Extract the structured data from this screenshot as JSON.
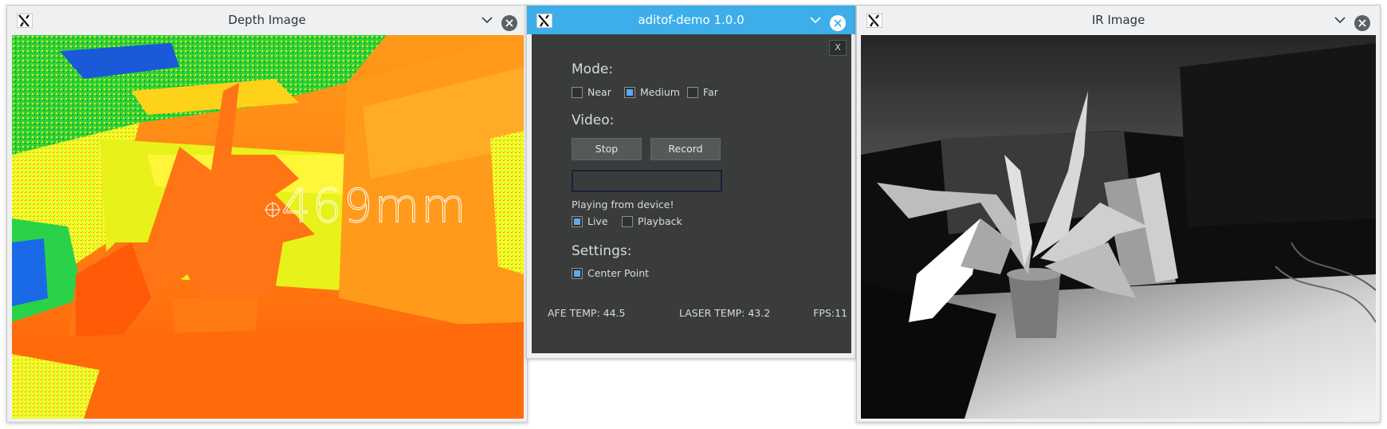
{
  "depth_window": {
    "title": "Depth Image",
    "overlay_reading": "469mm",
    "icons": {
      "app": "x11-app-icon",
      "minimize": "chevron-down-icon",
      "close": "close-icon"
    }
  },
  "demo_window": {
    "title": "aditof-demo 1.0.0",
    "close_label": "X",
    "mode": {
      "heading": "Mode:",
      "options": [
        {
          "label": "Near",
          "checked": false
        },
        {
          "label": "Medium",
          "checked": true
        },
        {
          "label": "Far",
          "checked": false
        }
      ]
    },
    "video": {
      "heading": "Video:",
      "stop_label": "Stop",
      "record_label": "Record",
      "filename_value": "",
      "status_text": "Playing from device!",
      "sources": [
        {
          "label": "Live",
          "checked": true
        },
        {
          "label": "Playback",
          "checked": false
        }
      ]
    },
    "settings": {
      "heading": "Settings:",
      "center_point_label": "Center Point",
      "center_point_checked": true
    },
    "footer": {
      "afe_temp": "AFE TEMP: 44.5",
      "laser_temp": "LASER TEMP: 43.2",
      "fps": "FPS:11"
    }
  },
  "ir_window": {
    "title": "IR Image"
  },
  "colors": {
    "titlebar_active": "#3daee9",
    "panel_bg": "#3a3c3b",
    "checkbox_on": "#5aa9ef"
  }
}
